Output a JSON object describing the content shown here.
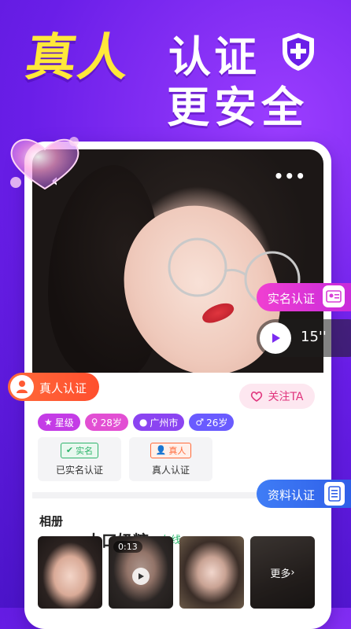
{
  "promo": {
    "headline_part1": "真人",
    "headline_part2": "认证",
    "headline_part3": "更安全"
  },
  "profile": {
    "name": "大口奶糖",
    "status": "在线",
    "follow_label": "关注TA",
    "voice_duration": "15''",
    "tags": {
      "star": "星级",
      "age": "28岁",
      "city": "广州市",
      "male_age": "26岁"
    },
    "verifications": [
      {
        "chip": "实名",
        "label": "已实名认证"
      },
      {
        "chip": "真人",
        "label": "真人认证"
      }
    ]
  },
  "badges": {
    "realname": "实名认证",
    "real_person": "真人认证",
    "info": "资料认证"
  },
  "album": {
    "title": "相册",
    "video_time": "0:13",
    "more_label": "更多"
  },
  "colors": {
    "background": "#6a1ee8",
    "headline_yellow": "#ffe83a",
    "online_green": "#2cb76d",
    "follow_pink": "#e0357d"
  }
}
